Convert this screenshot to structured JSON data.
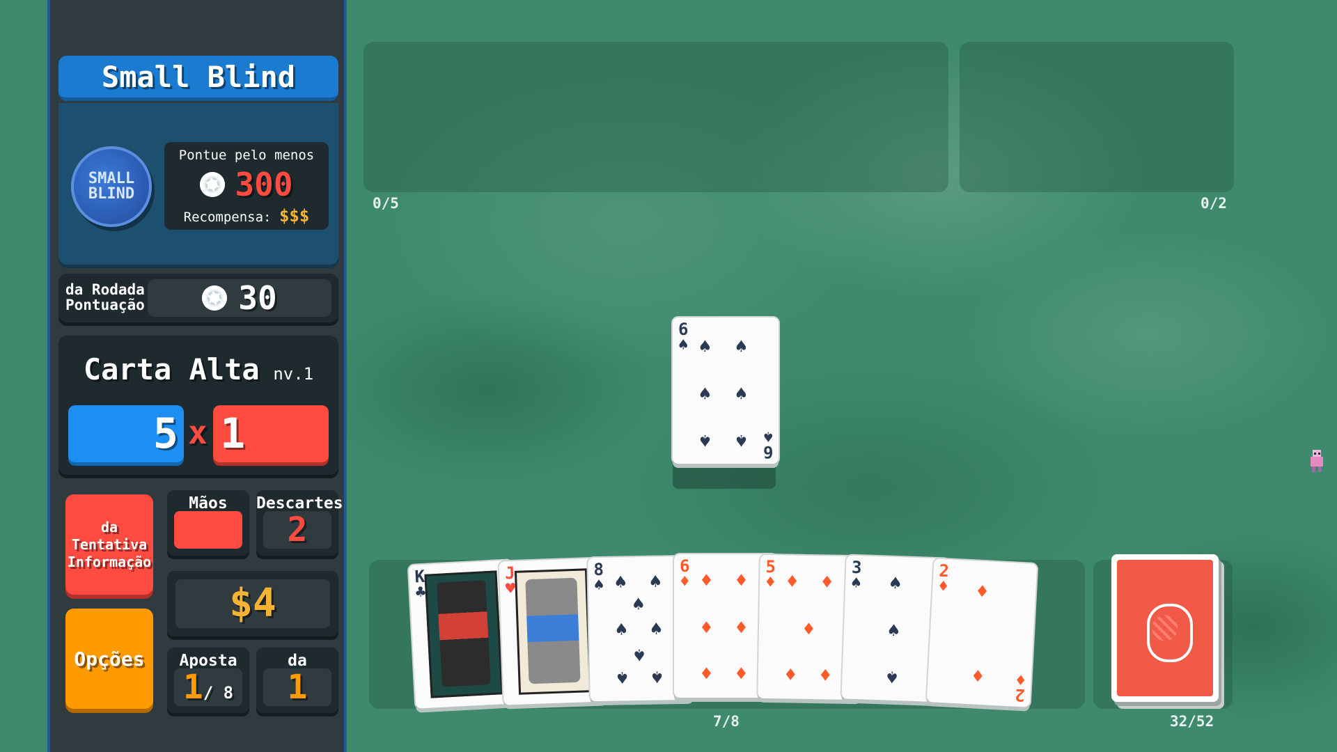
{
  "blind": {
    "name": "Small Blind",
    "chip_text": "SMALL BLIND",
    "target_label": "Pontue pelo menos",
    "target_score": "300",
    "reward_label": "Recompensa:",
    "reward_value": "$$$"
  },
  "round_score": {
    "label_line1": "da Rodada",
    "label_line2": "Pontuação",
    "value": "30"
  },
  "hand": {
    "name": "Carta Alta",
    "level": "nv.1",
    "chips": "5",
    "times": "x",
    "mult": "1"
  },
  "buttons": {
    "run_info_line1": "da Tentativa",
    "run_info_line2": "Informação",
    "options": "Opções"
  },
  "stats": {
    "hands_label": "Mãos",
    "hands_value": "",
    "discards_label": "Descartes",
    "discards_value": "2",
    "money": "$4",
    "ante_label": "Aposta",
    "ante_value": "1",
    "ante_of": "/ 8",
    "round_label": "da Rodada",
    "round_value": "1"
  },
  "board": {
    "joker_counter": "0/5",
    "consumable_counter": "0/2",
    "hand_counter": "7/8",
    "deck_counter": "32/52"
  },
  "played_card": {
    "rank": "6",
    "suit": "♠"
  },
  "hand_cards": [
    {
      "rank": "K",
      "suit": "♣"
    },
    {
      "rank": "J",
      "suit": "♥"
    },
    {
      "rank": "8",
      "suit": "♠"
    },
    {
      "rank": "6",
      "suit": "♦"
    },
    {
      "rank": "5",
      "suit": "♦"
    },
    {
      "rank": "3",
      "suit": "♠"
    },
    {
      "rank": "2",
      "suit": "♦"
    }
  ],
  "colors": {
    "chips_blue": "#1d8ff2",
    "mult_red": "#ff4b40",
    "money_gold": "#f5b335",
    "options_orange": "#ff9a00",
    "felt_green": "#3f8a6c"
  }
}
